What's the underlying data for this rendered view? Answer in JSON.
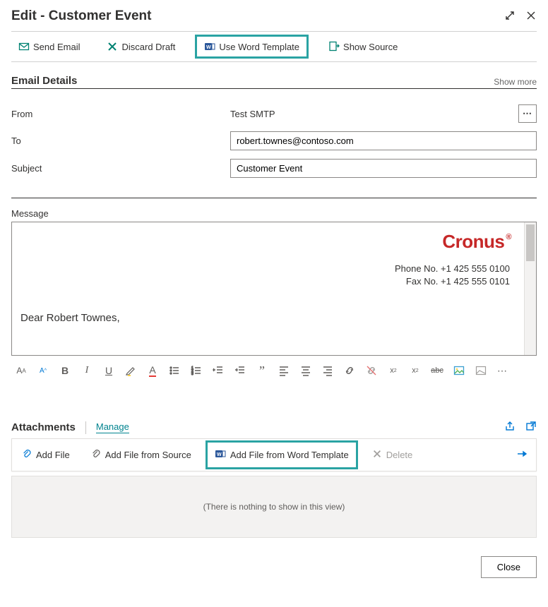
{
  "header": {
    "title": "Edit - Customer Event"
  },
  "toolbar": {
    "send_email": "Send Email",
    "discard_draft": "Discard Draft",
    "use_word_template": "Use Word Template",
    "show_source": "Show Source"
  },
  "section_email_details": {
    "title": "Email Details",
    "show_more": "Show more"
  },
  "form": {
    "from_label": "From",
    "from_value": "Test SMTP",
    "to_label": "To",
    "to_value": "robert.townes@contoso.com",
    "subject_label": "Subject",
    "subject_value": "Customer Event"
  },
  "message": {
    "label": "Message",
    "brand_name": "Cronus",
    "phone_line": "Phone No. +1 425 555 0100",
    "fax_line": "Fax No. +1 425 555 0101",
    "salutation": "Dear Robert Townes,"
  },
  "attachments": {
    "title": "Attachments",
    "manage": "Manage",
    "add_file": "Add File",
    "add_file_from_source": "Add File from Source",
    "add_file_from_word_template": "Add File from Word Template",
    "delete": "Delete",
    "empty_text": "(There is nothing to show in this view)"
  },
  "footer": {
    "close": "Close"
  }
}
